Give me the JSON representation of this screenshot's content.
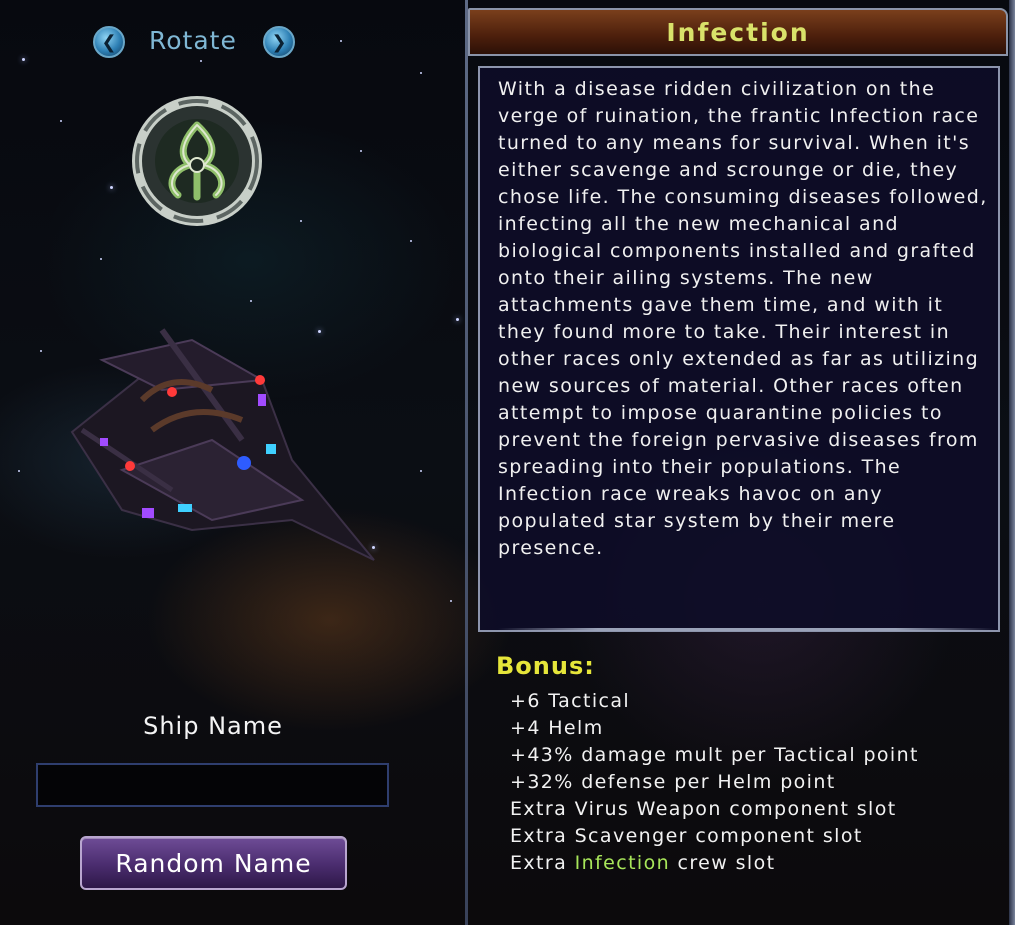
{
  "left_panel": {
    "rotate_label": "Rotate",
    "rotate_left_icon": "chevron-left-icon",
    "rotate_right_icon": "chevron-right-icon",
    "emblem_icon": "infection-race-emblem-icon",
    "ship_image": "infection-ship",
    "ship_name_label": "Ship Name",
    "ship_name_value": "",
    "random_name_button": "Random Name"
  },
  "right_panel": {
    "race_title": "Infection",
    "description": "With a disease ridden civilization on the verge of ruination, the frantic Infection race turned to any means for survival. When it's either scavenge and scrounge or die, they chose life. The consuming diseases followed, infecting all the new mechanical and biological components installed and grafted onto their ailing systems. The new attachments gave them time, and with it they found more to take. Their interest in other races only extended as far as utilizing new sources of material. Other races often attempt to impose quarantine policies to prevent the foreign pervasive diseases from spreading into their populations. The Infection race wreaks havoc on any populated star system by their mere presence.",
    "bonus_title": "Bonus:",
    "bonuses": [
      "+6 Tactical",
      "+4 Helm",
      "+43% damage mult per Tactical point",
      "+32% defense per Helm point",
      "Extra Virus Weapon component slot",
      "Extra Scavenger component slot"
    ],
    "last_bonus": {
      "prefix": "Extra ",
      "highlight": "Infection",
      "suffix": " crew slot"
    }
  },
  "colors": {
    "title_text": "#d9e26a",
    "bonus_title": "#e6e63a",
    "highlight": "#a8e65a",
    "rotate_text": "#7fb7d4"
  }
}
